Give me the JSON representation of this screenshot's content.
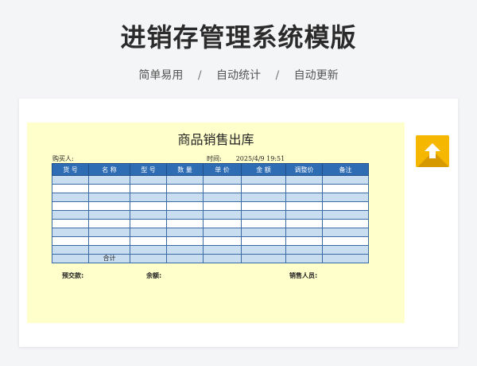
{
  "header": {
    "title": "进销存管理系统模版",
    "features": [
      "简单易用",
      "自动统计",
      "自动更新"
    ],
    "separator": "/"
  },
  "sheet": {
    "title": "商品销售出库",
    "buyer_label": "购买人:",
    "time_label": "时间:",
    "time_value": "2025/4/9  19:51",
    "columns": [
      "货 号",
      "名 称",
      "型 号",
      "数 量",
      "单 价",
      "金 额",
      "调整价",
      "备注"
    ],
    "total_label": "合计",
    "footer": {
      "deposit_label": "预交款:",
      "balance_label": "余额:",
      "salesperson_label": "销售人员:"
    }
  },
  "icons": {
    "upload": "upload-arrow-icon"
  },
  "colors": {
    "header_blue": "#2e6db4",
    "row_blue": "#c9ddf0",
    "sheet_bg": "#ffffcc",
    "accent_yellow": "#f5b700"
  }
}
